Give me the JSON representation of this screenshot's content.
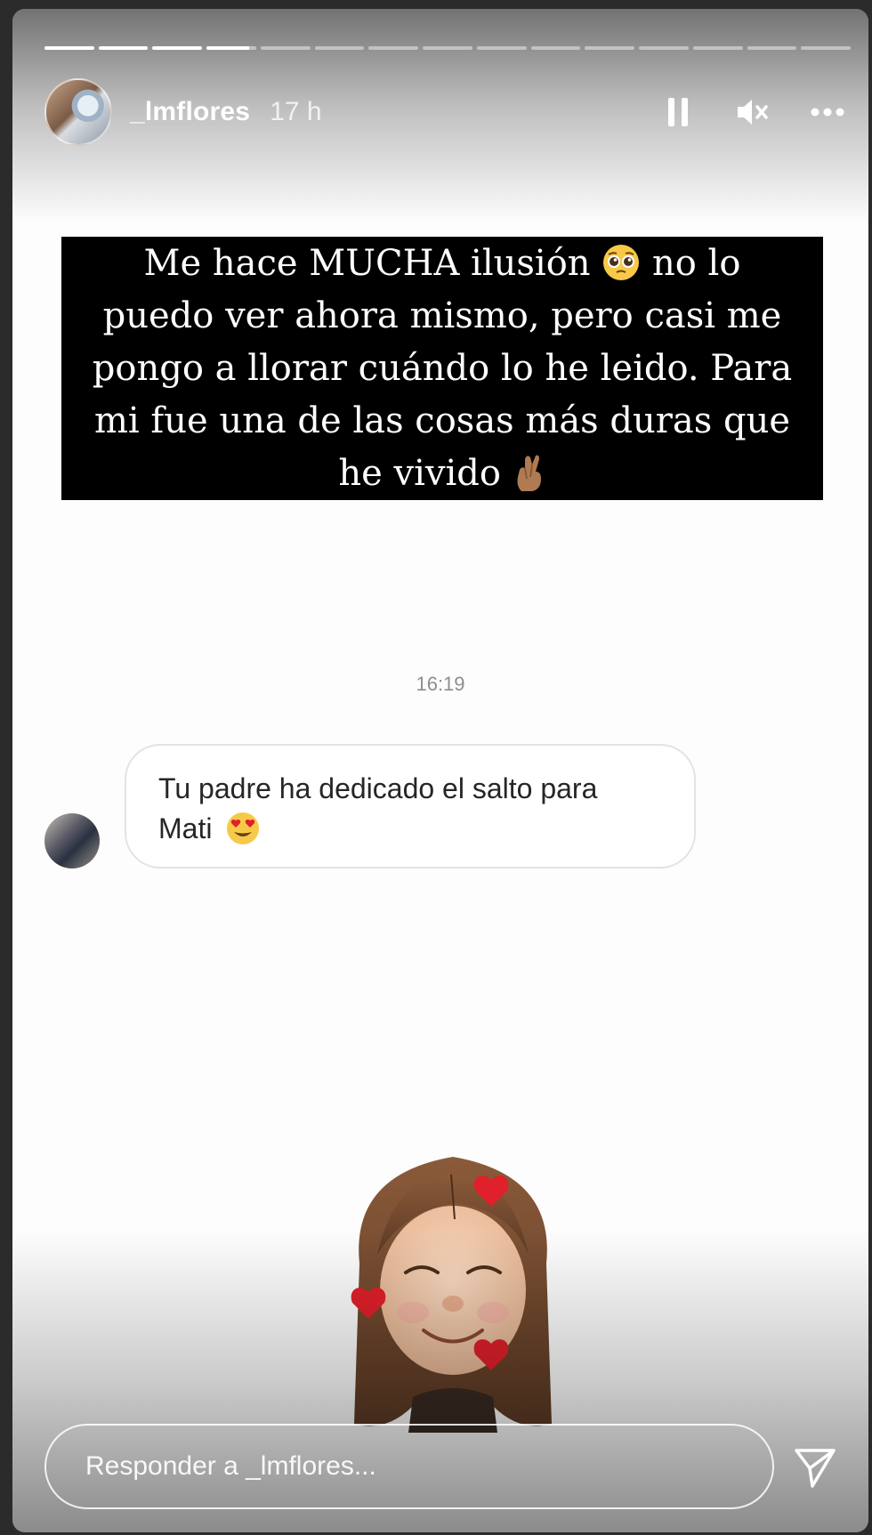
{
  "story": {
    "username": "_lmflores",
    "time_ago": "17 h",
    "progress": {
      "total_segments": 15,
      "completed_segments": 3,
      "current_segment_fraction": 0.85
    },
    "controls": {
      "pause": "pause-icon",
      "mute": "muted-speaker-icon",
      "more": "more-dots-icon"
    }
  },
  "banner": {
    "lines": [
      "Me hace MUCHA ilusión",
      "no lo",
      "puedo ver ahora mismo, pero casi me",
      "pongo a llorar cuándo lo he leido. Para",
      "mi fue una de las cosas más duras que",
      "he vivido"
    ],
    "emoji_1": "pleading-face-icon",
    "emoji_2": "crossed-fingers-icon"
  },
  "chat": {
    "timestamp": "16:19",
    "message_line_1": "Tu padre ha dedicado el salto para",
    "message_line_2": "Mati",
    "message_emoji": "heart-eyes-face-icon"
  },
  "sticker": "memoji-hearts-icon",
  "reply": {
    "placeholder": "Responder a _lmflores..."
  },
  "colors": {
    "banner_bg": "#000000",
    "banner_text": "#ffffff",
    "bubble_border": "#e3e3e3",
    "heart_red": "#e0202a"
  }
}
